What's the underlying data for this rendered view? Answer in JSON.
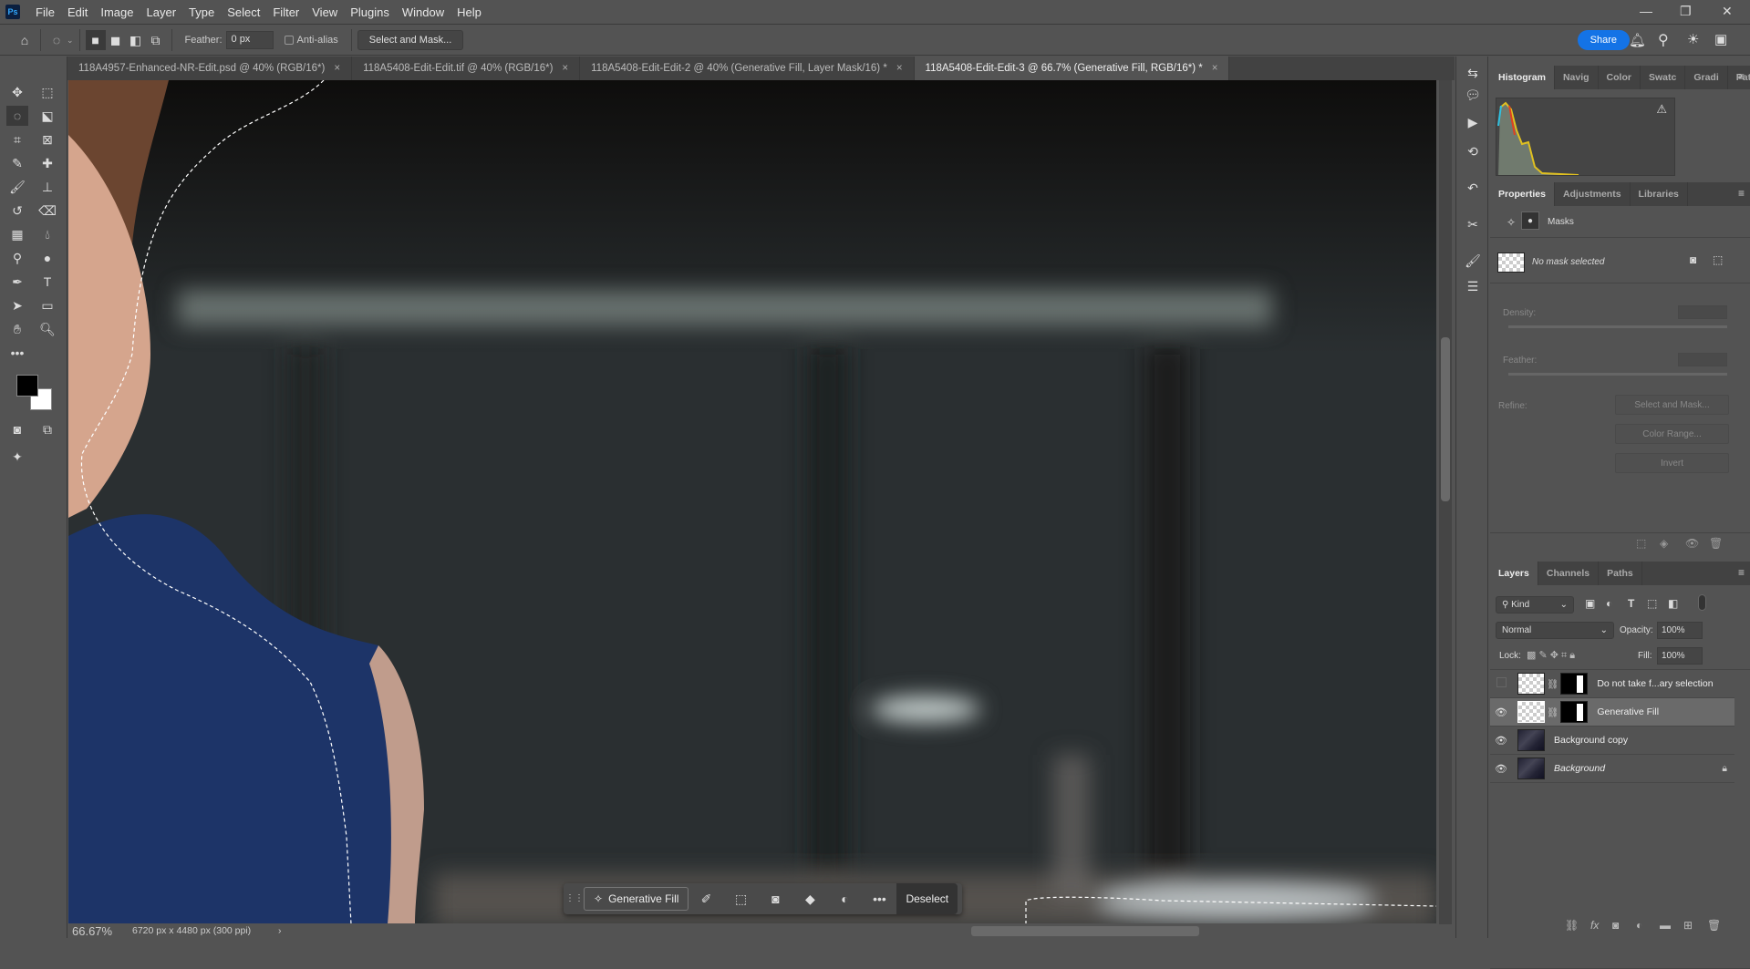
{
  "app": {
    "logo": "Ps",
    "menu": [
      "File",
      "Edit",
      "Image",
      "Layer",
      "Type",
      "Select",
      "Filter",
      "View",
      "Plugins",
      "Window",
      "Help"
    ]
  },
  "options": {
    "feather_label": "Feather:",
    "feather_value": "0 px",
    "antialias_label": "Anti-alias",
    "select_mask": "Select and Mask...",
    "share": "Share"
  },
  "tabs": [
    {
      "label": "118A4957-Enhanced-NR-Edit.psd @ 40% (RGB/16*)"
    },
    {
      "label": "118A5408-Edit-Edit.tif @ 40% (RGB/16*)"
    },
    {
      "label": "118A5408-Edit-Edit-2 @ 40% (Generative Fill, Layer Mask/16) *"
    },
    {
      "label": "118A5408-Edit-Edit-3 @ 66.7% (Generative Fill, RGB/16*) *"
    }
  ],
  "status": {
    "zoom": "66.67%",
    "doc_info": "6720 px x 4480 px (300 ppi)"
  },
  "context_bar": {
    "generative_fill": "Generative Fill",
    "deselect": "Deselect"
  },
  "histogram_tabs": [
    "Histogram",
    "Navig",
    "Color",
    "Swatc",
    "Gradi",
    "Patter"
  ],
  "properties": {
    "tabs": [
      "Properties",
      "Adjustments",
      "Libraries"
    ],
    "section": "Masks",
    "no_mask": "No mask selected",
    "density": "Density:",
    "feather": "Feather:",
    "refine": "Refine:",
    "buttons": [
      "Select and Mask...",
      "Color Range...",
      "Invert"
    ]
  },
  "layers": {
    "tabs": [
      "Layers",
      "Channels",
      "Paths"
    ],
    "filter": "Kind",
    "blend": "Normal",
    "opacity_label": "Opacity:",
    "opacity": "100%",
    "lock_label": "Lock:",
    "fill_label": "Fill:",
    "fill": "100%",
    "items": [
      {
        "name": "Do not take f...ary selection",
        "visible": false
      },
      {
        "name": "Generative Fill",
        "visible": true,
        "selected": true
      },
      {
        "name": "Background copy",
        "visible": true
      },
      {
        "name": "Background",
        "visible": true,
        "locked": true
      }
    ]
  }
}
